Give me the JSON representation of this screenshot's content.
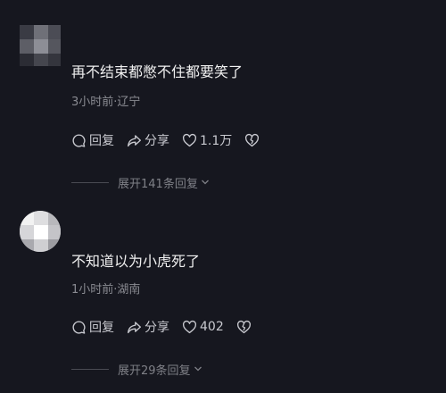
{
  "comments": [
    {
      "text": "再不结束都憋不住都要笑了",
      "meta": "3小时前·辽宁",
      "reply_label": "回复",
      "share_label": "分享",
      "like_count": "1.1万",
      "expand_label": "展开141条回复"
    },
    {
      "text": "不知道以为小虎死了",
      "meta": "1小时前·湖南",
      "reply_label": "回复",
      "share_label": "分享",
      "like_count": "402",
      "expand_label": "展开29条回复"
    }
  ],
  "colors": {
    "background": "#16171f",
    "text_primary": "#f0f0f0",
    "text_meta": "#8a8b92",
    "action_text": "#c9cad0"
  },
  "icons": [
    "reply-icon",
    "share-icon",
    "like-heart-icon",
    "dislike-broken-heart-icon",
    "chevron-down-icon"
  ]
}
